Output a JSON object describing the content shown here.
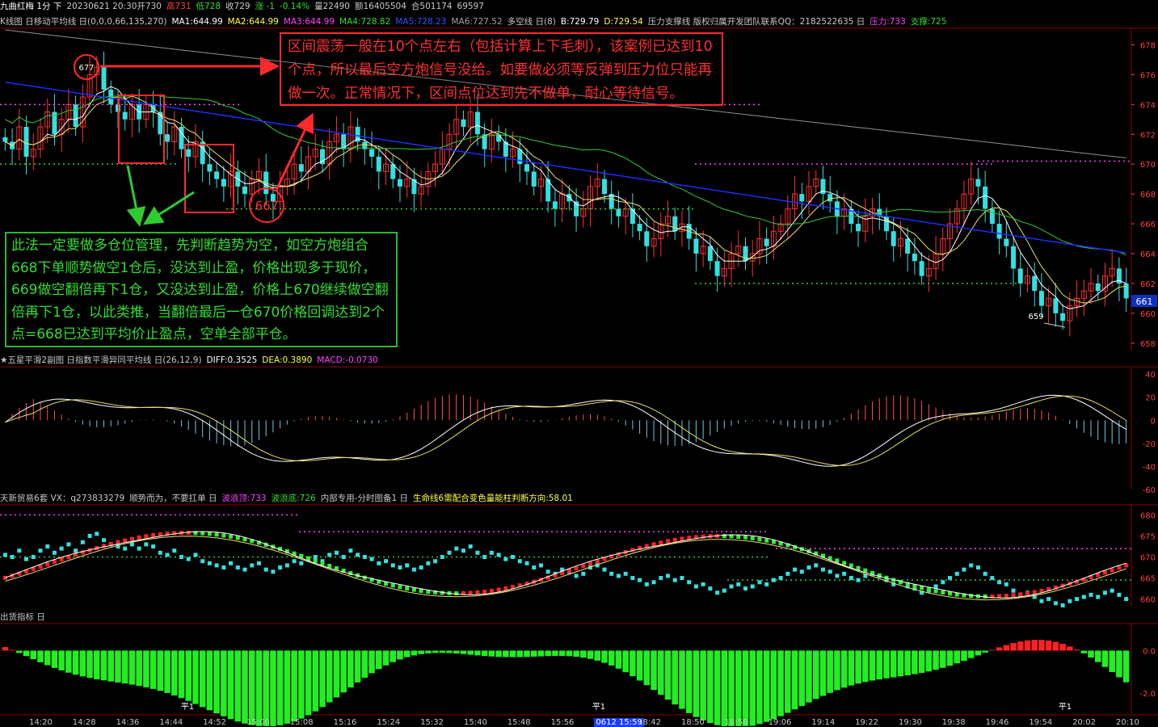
{
  "header": {
    "items": [
      {
        "text": "九曲红梅 1分 下",
        "color": "#ffffff"
      },
      {
        "text": "20230621 20:30开730",
        "color": "#c8c8c8"
      },
      {
        "text": "高731",
        "color": "#ff4040"
      },
      {
        "text": "低728",
        "color": "#33dd33"
      },
      {
        "text": "收729",
        "color": "#c8c8c8"
      },
      {
        "text": "涨 -1",
        "color": "#33dd33"
      },
      {
        "text": "-0.14%",
        "color": "#33dd33"
      },
      {
        "text": "量22490",
        "color": "#c8c8c8"
      },
      {
        "text": "额16405504",
        "color": "#c8c8c8"
      },
      {
        "text": "合501174",
        "color": "#c8c8c8"
      },
      {
        "text": "69597",
        "color": "#c8c8c8"
      }
    ]
  },
  "main_title": {
    "items": [
      {
        "text": "K线图 日移动平均线 日(0,0,0,66,135,270)",
        "color": "#c8c8c8"
      },
      {
        "text": "MA1:644.99",
        "color": "#ffffff"
      },
      {
        "text": "MA2:644.99",
        "color": "#ffff40"
      },
      {
        "text": "MA3:644.99",
        "color": "#ff40ff"
      },
      {
        "text": "MA4:728.82",
        "color": "#33dd33"
      },
      {
        "text": "MA5:728.23",
        "color": "#3050ff"
      },
      {
        "text": "MA6:727.52",
        "color": "#a0a0a0"
      },
      {
        "text": "多空线 日(8)",
        "color": "#c8c8c8"
      },
      {
        "text": "B:729.79",
        "color": "#ffffff"
      },
      {
        "text": "D:729.54",
        "color": "#ffff40"
      },
      {
        "text": "压力支撑线 版权归属开发团队联系QQ：2182522635 日",
        "color": "#c8c8c8"
      },
      {
        "text": "压力:733",
        "color": "#ff40ff"
      },
      {
        "text": "支撑:725",
        "color": "#33dd33"
      }
    ]
  },
  "macd_title": {
    "items": [
      {
        "text": "★五星平滑2副图 日指数平滑异同平均线 日(26,12,9)",
        "color": "#c8c8c8"
      },
      {
        "text": "DIFF:0.3525",
        "color": "#ffffff"
      },
      {
        "text": "DEA:0.3890",
        "color": "#ffff40"
      },
      {
        "text": "MACD:-0.0730",
        "color": "#ff40ff"
      }
    ]
  },
  "wave_title": {
    "items": [
      {
        "text": "天新贸易6套 VX：q273833279",
        "color": "#c8c8c8"
      },
      {
        "text": "顺势而为，不要扛单 日",
        "color": "#c8c8c8"
      },
      {
        "text": "波浪顶:733",
        "color": "#ff40ff"
      },
      {
        "text": "波浪底:726",
        "color": "#33dd33"
      },
      {
        "text": "内部专用-分时图备1 日",
        "color": "#c8c8c8"
      },
      {
        "text": "生命线6需配合变色量能柱判断方向:58.01",
        "color": "#ffff40"
      }
    ]
  },
  "ship_title": {
    "items": [
      {
        "text": "出货指标 日",
        "color": "#c8c8c8"
      }
    ]
  },
  "annotations": {
    "red_note": "区间震荡一般在10个点左右（包括计算上下毛刺），该案例已达到10个点，所以最后空方炮信号没给。如要做必须等反弹到压力位只能再做一次。正常情况下，区间点位达到先不做单，耐心等待信号。",
    "green_note": "此法一定要做多仓位管理，先判断趋势为空，如空方炮组合668下单顺势做空1仓后，没达到止盈，价格出现多于现价，669做空翻倍再下1仓，又没达到止盈，价格上670继续做空翻倍再下1仓，以此类推，当翻倍最后一仓670价格回调达到2个点=668已达到平均价止盈点，空单全部平仓。",
    "circle_677": "677",
    "circle_667": "667",
    "label_659": "659",
    "current_price": "661",
    "ping_labels": [
      "平1",
      "平1",
      "平1"
    ]
  },
  "x_axis": {
    "ticks": [
      "14:20",
      "14:28",
      "14:36",
      "14:44",
      "14:52",
      "15:00",
      "15:08",
      "15:16",
      "15:24",
      "15:32",
      "15:40",
      "15:48",
      "15:56",
      "0612 15:59",
      "18:42",
      "18:50",
      "18:58",
      "19:06",
      "19:14",
      "19:22",
      "19:30",
      "19:38",
      "19:46",
      "19:54",
      "20:02",
      "20:10"
    ],
    "highlight": "0612 15:59"
  },
  "colors": {
    "up": "#ff3030",
    "down": "#33e0e0",
    "ma_white": "#ffffff",
    "ma_yellow": "#e8e060",
    "ma_green": "#33cc33",
    "ma_blue": "#2030ff",
    "ma_gray": "#909090",
    "grid_red": "#8b0000"
  },
  "chart_data": [
    {
      "type": "candlestick",
      "title": "九曲红梅 1分",
      "y_ticks": [
        678,
        676,
        674,
        672,
        670,
        668,
        666,
        664,
        662,
        660,
        658
      ],
      "ylim": [
        657.5,
        679
      ],
      "levels": {
        "resistance_1": 674,
        "support_1": 670,
        "resistance_2": 670,
        "support_2": 667,
        "support_3": 662
      },
      "close": [
        671.5,
        671,
        672.5,
        670.5,
        671,
        672.5,
        673.5,
        672,
        673,
        674,
        672.5,
        674.5,
        676,
        676.5,
        675,
        674,
        673.5,
        673,
        674,
        673,
        674,
        673.5,
        672,
        671.5,
        672.5,
        671,
        670.5,
        671.5,
        670,
        669.5,
        669,
        668.5,
        669.5,
        668.5,
        668,
        669,
        669.5,
        668,
        667.5,
        668.5,
        669,
        670,
        669.5,
        670.5,
        671,
        670,
        671.5,
        672,
        671,
        672.5,
        671.5,
        671,
        670.5,
        669.5,
        670,
        669,
        668.5,
        669,
        668,
        668.5,
        669.5,
        670,
        671,
        672,
        673,
        672.5,
        673.5,
        672,
        671,
        672,
        671.5,
        670.5,
        671,
        670,
        669.5,
        668.5,
        669,
        667.5,
        667,
        668,
        667.5,
        666.5,
        667,
        668.5,
        669,
        668,
        667,
        666.5,
        667,
        666,
        665.5,
        664.5,
        665,
        666,
        666.5,
        665.5,
        666,
        665,
        664,
        664.5,
        663.5,
        662.5,
        663,
        664,
        664.5,
        663.5,
        664,
        665,
        664.5,
        665.5,
        666,
        667,
        668,
        667.5,
        668.5,
        669,
        668,
        667.5,
        666.5,
        667,
        666,
        665.5,
        666.5,
        667,
        666.5,
        665.5,
        664.5,
        665,
        664,
        663.5,
        662.5,
        663,
        664,
        665,
        666,
        667,
        668,
        669,
        668.5,
        667,
        666,
        665,
        664.5,
        663,
        662,
        662.5,
        661.5,
        660.5,
        661,
        660,
        659.5,
        660.5,
        661,
        661.5,
        662,
        661.5,
        662.5,
        663,
        662,
        661
      ],
      "series": [
        {
          "name": "MA4",
          "color": "#33cc33"
        },
        {
          "name": "MA5",
          "color": "#2030ff"
        },
        {
          "name": "MA6",
          "color": "#909090"
        }
      ]
    },
    {
      "type": "bar",
      "title": "MACD",
      "y_ticks": [
        40,
        20,
        0,
        -20,
        -40,
        -60
      ],
      "ylim": [
        -60,
        45
      ],
      "series_names": [
        "DIFF",
        "DEA",
        "MACD"
      ]
    },
    {
      "type": "scatter",
      "title": "波浪",
      "y_ticks": [
        680,
        675,
        670,
        665,
        660
      ],
      "ylim": [
        658,
        682
      ],
      "levels": {
        "wave_top": 676,
        "wave_bottom": 665.5
      }
    },
    {
      "type": "bar",
      "title": "出货指标",
      "y_ticks": [
        "0.0",
        "-2.0"
      ],
      "ylim": [
        -3,
        1.2
      ]
    }
  ]
}
